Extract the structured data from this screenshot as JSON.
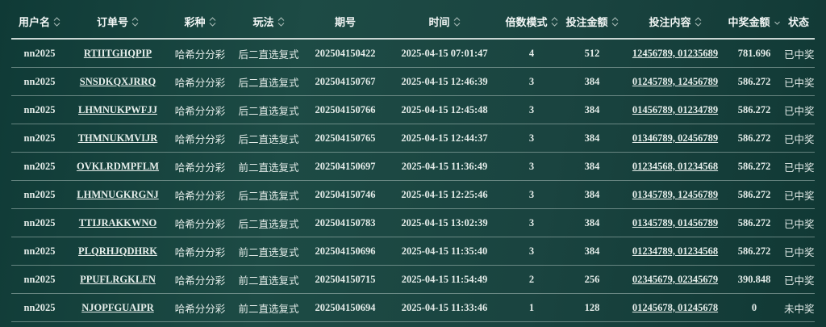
{
  "table": {
    "columns": [
      {
        "key": "user",
        "label": "用户名",
        "sortable": true,
        "icon": "sort-icon"
      },
      {
        "key": "order",
        "label": "订单号",
        "sortable": true,
        "icon": "sort-icon"
      },
      {
        "key": "lottery",
        "label": "彩种",
        "sortable": true,
        "icon": "sort-icon"
      },
      {
        "key": "play",
        "label": "玩法",
        "sortable": true,
        "icon": "sort-icon"
      },
      {
        "key": "issue",
        "label": "期号",
        "sortable": false
      },
      {
        "key": "time",
        "label": "时间",
        "sortable": true,
        "icon": "sort-icon"
      },
      {
        "key": "mode",
        "label": "倍数模式",
        "sortable": true,
        "icon": "sort-icon"
      },
      {
        "key": "amount",
        "label": "投注金额",
        "sortable": true,
        "icon": "sort-icon"
      },
      {
        "key": "content",
        "label": "投注内容",
        "sortable": true,
        "icon": "sort-icon"
      },
      {
        "key": "win",
        "label": "中奖金额",
        "sortable": true,
        "icon": "sort-desc-icon"
      },
      {
        "key": "status",
        "label": "状态",
        "sortable": false
      }
    ],
    "rows": [
      {
        "user": "nn2025",
        "order": "RTIITGHQPIP",
        "lottery": "哈希分分彩",
        "play": "后二直选复式",
        "issue": "202504150422",
        "time": "2025-04-15 07:01:47",
        "mode": "4",
        "amount": "512",
        "content": "12456789, 01235689",
        "win": "781.696",
        "status": "已中奖"
      },
      {
        "user": "nn2025",
        "order": "SNSDKQXJRRQ",
        "lottery": "哈希分分彩",
        "play": "后二直选复式",
        "issue": "202504150767",
        "time": "2025-04-15 12:46:39",
        "mode": "3",
        "amount": "384",
        "content": "01245789, 12456789",
        "win": "586.272",
        "status": "已中奖"
      },
      {
        "user": "nn2025",
        "order": "LHMNUKPWFJJ",
        "lottery": "哈希分分彩",
        "play": "后二直选复式",
        "issue": "202504150766",
        "time": "2025-04-15 12:45:48",
        "mode": "3",
        "amount": "384",
        "content": "01456789, 01234789",
        "win": "586.272",
        "status": "已中奖"
      },
      {
        "user": "nn2025",
        "order": "THMNUKMVIJR",
        "lottery": "哈希分分彩",
        "play": "后二直选复式",
        "issue": "202504150765",
        "time": "2025-04-15 12:44:37",
        "mode": "3",
        "amount": "384",
        "content": "01346789, 02456789",
        "win": "586.272",
        "status": "已中奖"
      },
      {
        "user": "nn2025",
        "order": "OVKLRDMPFLM",
        "lottery": "哈希分分彩",
        "play": "前二直选复式",
        "issue": "202504150697",
        "time": "2025-04-15 11:36:49",
        "mode": "3",
        "amount": "384",
        "content": "01234568, 01234568",
        "win": "586.272",
        "status": "已中奖"
      },
      {
        "user": "nn2025",
        "order": "LHMNUGKRGNJ",
        "lottery": "哈希分分彩",
        "play": "后二直选复式",
        "issue": "202504150746",
        "time": "2025-04-15 12:25:46",
        "mode": "3",
        "amount": "384",
        "content": "01345789, 12456789",
        "win": "586.272",
        "status": "已中奖"
      },
      {
        "user": "nn2025",
        "order": "TTIJRAKKWNO",
        "lottery": "哈希分分彩",
        "play": "后二直选复式",
        "issue": "202504150783",
        "time": "2025-04-15 13:02:39",
        "mode": "3",
        "amount": "384",
        "content": "01345789, 01456789",
        "win": "586.272",
        "status": "已中奖"
      },
      {
        "user": "nn2025",
        "order": "PLQRHJQDHRK",
        "lottery": "哈希分分彩",
        "play": "前二直选复式",
        "issue": "202504150696",
        "time": "2025-04-15 11:35:40",
        "mode": "3",
        "amount": "384",
        "content": "01234789, 01234568",
        "win": "586.272",
        "status": "已中奖"
      },
      {
        "user": "nn2025",
        "order": "PPUFLRGKLFN",
        "lottery": "哈希分分彩",
        "play": "前二直选复式",
        "issue": "202504150715",
        "time": "2025-04-15 11:54:49",
        "mode": "2",
        "amount": "256",
        "content": "02345679, 02345679",
        "win": "390.848",
        "status": "已中奖"
      },
      {
        "user": "nn2025",
        "order": "NJOPFGUAIPR",
        "lottery": "哈希分分彩",
        "play": "前二直选复式",
        "issue": "202504150694",
        "time": "2025-04-15 11:33:46",
        "mode": "1",
        "amount": "128",
        "content": "01245678, 01245678",
        "win": "0",
        "status": "未中奖"
      }
    ]
  }
}
